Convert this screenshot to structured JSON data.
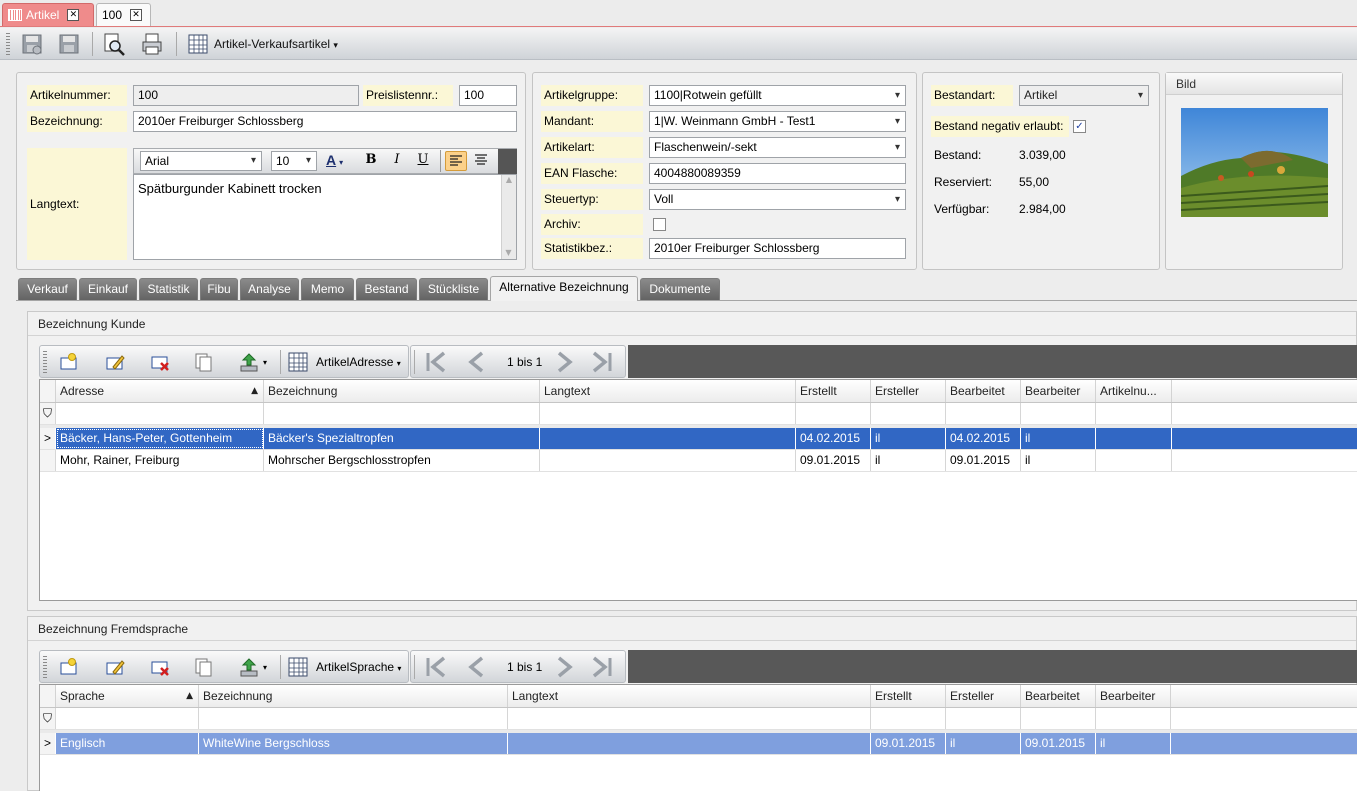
{
  "doc_tabs": [
    {
      "label": "Artikel",
      "active": true
    },
    {
      "label": "100",
      "active": false
    }
  ],
  "toolbar": {
    "view_label": "Artikel-Verkaufsartikel"
  },
  "form": {
    "artikelnummer_label": "Artikelnummer:",
    "artikelnummer": "100",
    "preislistennr_label": "Preislistennr.:",
    "preislistennr": "100",
    "bezeichnung_label": "Bezeichnung:",
    "bezeichnung": "2010er Freiburger Schlossberg",
    "langtext_label": "Langtext:",
    "langtext": "Spätburgunder Kabinett trocken",
    "font_name": "Arial",
    "font_size": "10",
    "fmt_color": "A",
    "fmt_bold": "B",
    "fmt_italic": "I",
    "fmt_underline": "U"
  },
  "form2": {
    "artikelgruppe_label": "Artikelgruppe:",
    "artikelgruppe": "1100|Rotwein gefüllt",
    "mandant_label": "Mandant:",
    "mandant": "1|W. Weinmann GmbH - Test1",
    "artikelart_label": "Artikelart:",
    "artikelart": "Flaschenwein/-sekt",
    "ean_label": "EAN Flasche:",
    "ean": "4004880089359",
    "steuertyp_label": "Steuertyp:",
    "steuertyp": "Voll",
    "archiv_label": "Archiv:",
    "statistik_label": "Statistikbez.:",
    "statistik": "2010er Freiburger Schlossberg"
  },
  "stock": {
    "bestandart_label": "Bestandart:",
    "bestandart": "Artikel",
    "negativ_label": "Bestand negativ erlaubt:",
    "negativ_checked": "✓",
    "bestand_label": "Bestand:",
    "bestand": "3.039,00",
    "reserviert_label": "Reserviert:",
    "reserviert": "55,00",
    "verfuegbar_label": "Verfügbar:",
    "verfuegbar": "2.984,00"
  },
  "bild": {
    "title": "Bild"
  },
  "page_tabs": [
    "Verkauf",
    "Einkauf",
    "Statistik",
    "Fibu",
    "Analyse",
    "Memo",
    "Bestand",
    "Stückliste",
    "Alternative Bezeichnung",
    "Dokumente"
  ],
  "section1": {
    "title": "Bezeichnung Kunde",
    "view": "ArtikelAdresse",
    "pager": "1 bis 1",
    "columns": [
      "Adresse",
      "Bezeichnung",
      "Langtext",
      "Erstellt",
      "Ersteller",
      "Bearbeitet",
      "Bearbeiter",
      "Artikelnu..."
    ],
    "rows": [
      [
        "Bäcker, Hans-Peter, Gottenheim",
        "Bäcker's Spezialtropfen",
        "",
        "04.02.2015",
        "il",
        "04.02.2015",
        "il",
        ""
      ],
      [
        "Mohr, Rainer, Freiburg",
        "Mohrscher Bergschlosstropfen",
        "",
        "09.01.2015",
        "il",
        "09.01.2015",
        "il",
        ""
      ]
    ]
  },
  "section2": {
    "title": "Bezeichnung Fremdsprache",
    "view": "ArtikelSprache",
    "pager": "1 bis 1",
    "columns": [
      "Sprache",
      "Bezeichnung",
      "Langtext",
      "Erstellt",
      "Ersteller",
      "Bearbeitet",
      "Bearbeiter"
    ],
    "rows": [
      [
        "Englisch",
        "WhiteWine Bergschloss",
        "",
        "09.01.2015",
        "il",
        "09.01.2015",
        "il"
      ]
    ]
  },
  "colors": {
    "active_tab": "#ef8b8b",
    "selection": "#3167c4",
    "selection_secondary": "#7f9fde",
    "label_bg": "#fbf7d6"
  }
}
